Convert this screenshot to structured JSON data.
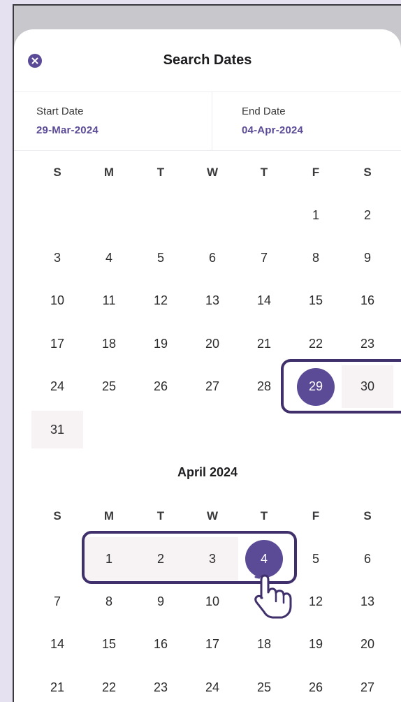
{
  "header": {
    "title": "Search Dates",
    "close_icon": "close-icon"
  },
  "range": {
    "start_label": "Start Date",
    "start_value": "29-Mar-2024",
    "end_label": "End Date",
    "end_value": "04-Apr-2024"
  },
  "weekdays": [
    "S",
    "M",
    "T",
    "W",
    "T",
    "F",
    "S"
  ],
  "march": {
    "weeks": [
      [
        "",
        "",
        "",
        "",
        "",
        "1",
        "2"
      ],
      [
        "3",
        "4",
        "5",
        "6",
        "7",
        "8",
        "9"
      ],
      [
        "10",
        "11",
        "12",
        "13",
        "14",
        "15",
        "16"
      ],
      [
        "17",
        "18",
        "19",
        "20",
        "21",
        "22",
        "23"
      ],
      [
        "24",
        "25",
        "26",
        "27",
        "28",
        "29",
        "30"
      ],
      [
        "31",
        "",
        "",
        "",
        "",
        "",
        ""
      ]
    ]
  },
  "april": {
    "title": "April 2024",
    "weeks": [
      [
        "",
        "1",
        "2",
        "3",
        "4",
        "5",
        "6"
      ],
      [
        "7",
        "8",
        "9",
        "10",
        "11",
        "12",
        "13"
      ],
      [
        "14",
        "15",
        "16",
        "17",
        "18",
        "19",
        "20"
      ],
      [
        "21",
        "22",
        "23",
        "24",
        "25",
        "26",
        "27"
      ]
    ]
  },
  "colors": {
    "accent": "#5b4a96",
    "range_bg": "#f7f2f4",
    "highlight_border": "#3f2f6a"
  }
}
